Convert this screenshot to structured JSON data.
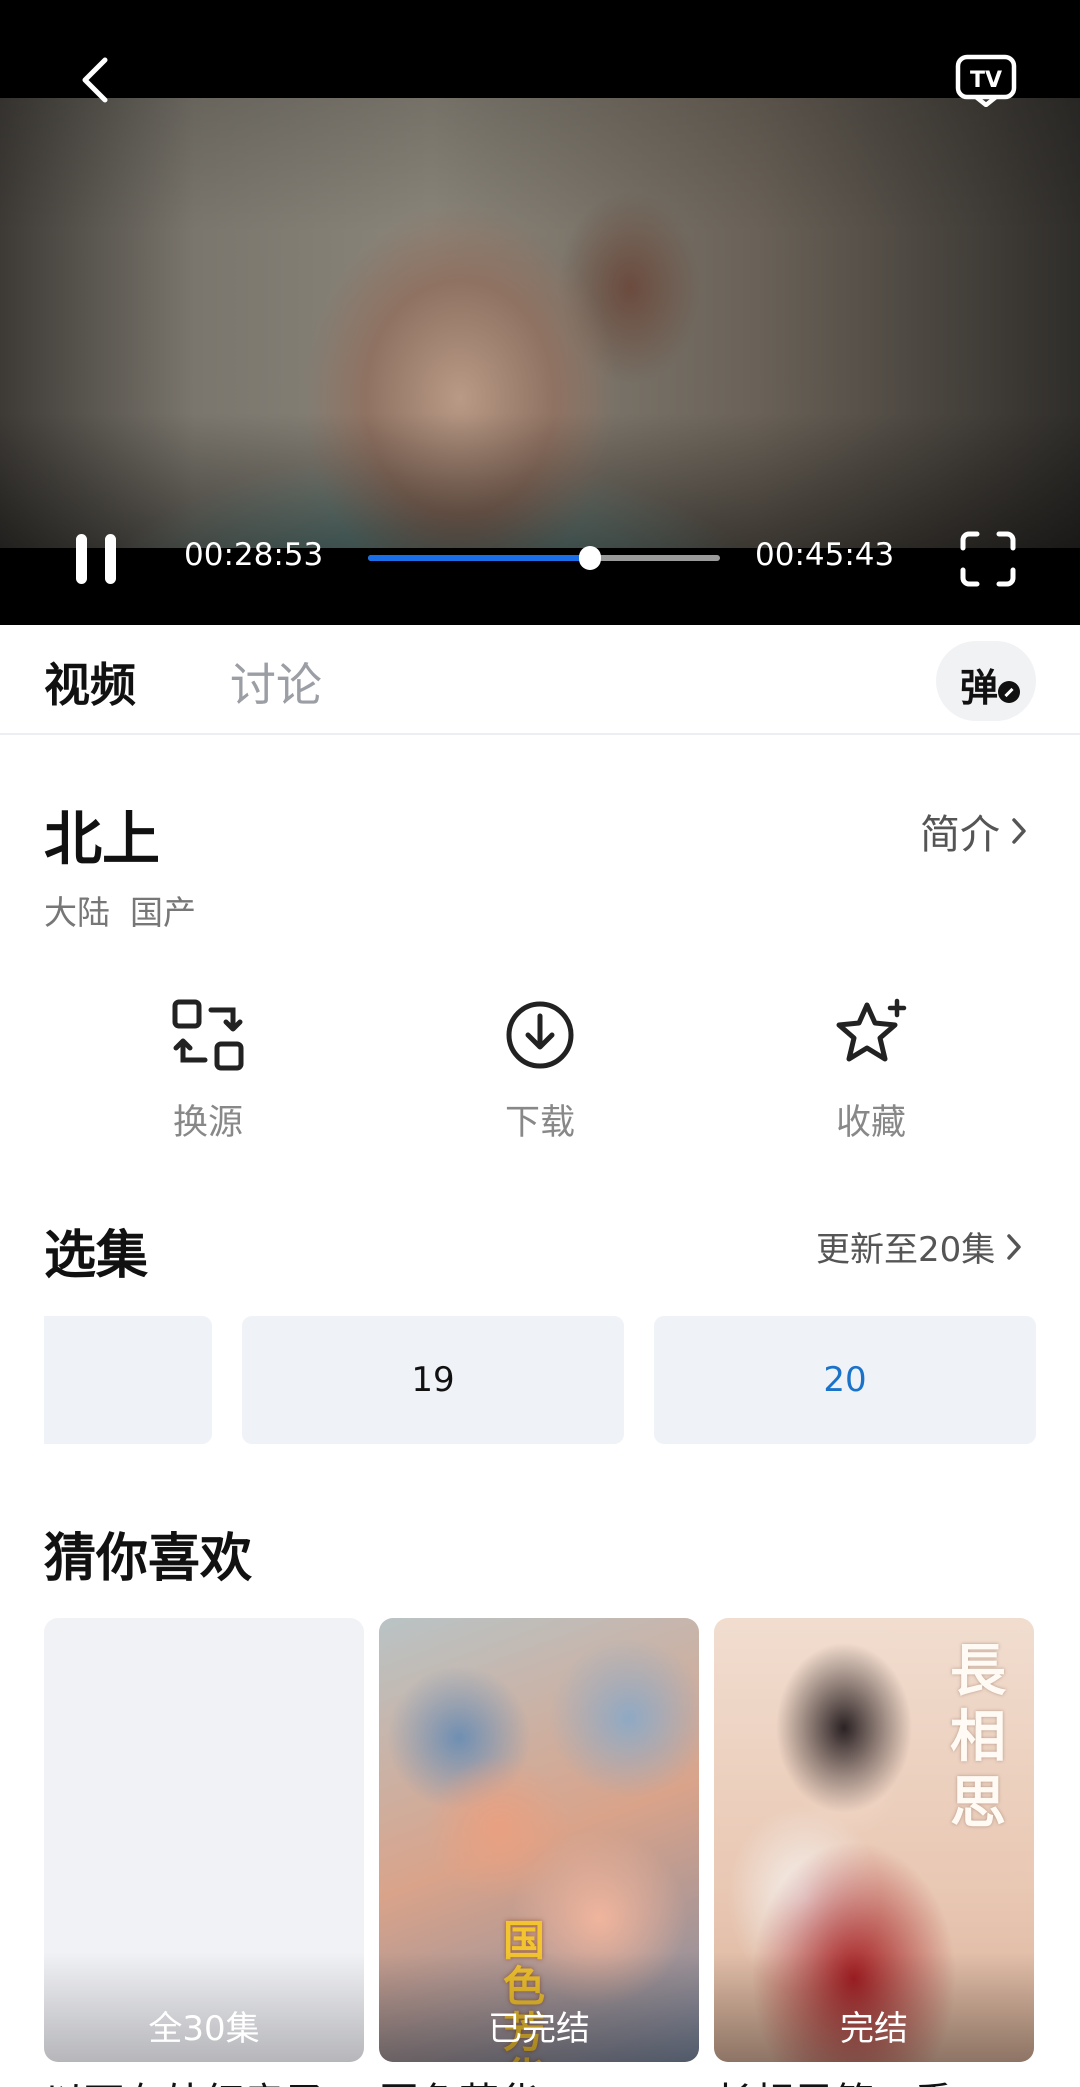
{
  "player": {
    "time_current": "00:28:53",
    "time_total": "00:45:43",
    "progress_fraction": 0.632,
    "accent_color": "#1a6fe8"
  },
  "tabs": {
    "video": "视频",
    "discuss": "讨论",
    "danmaku": "弹"
  },
  "show": {
    "title": "北上",
    "intro_link": "简介",
    "meta": [
      "大陆",
      "国产"
    ]
  },
  "actions": {
    "switch_source": "换源",
    "download": "下载",
    "favorite": "收藏"
  },
  "episodes": {
    "title": "选集",
    "update_status": "更新至20集",
    "items": [
      "19",
      "20"
    ],
    "selected_color": "#1a73c9"
  },
  "recommend": {
    "title": "猜你喜欢",
    "cards": [
      {
        "badge": "全30集",
        "title": "以下有处红房子"
      },
      {
        "badge": "已完结",
        "title": "国色芳华",
        "poster_text": "国色芳华"
      },
      {
        "badge": "完结",
        "title": "长相思第一季",
        "poster_text": "長相思"
      }
    ]
  },
  "icons": [
    "back-icon",
    "tv-cast-icon",
    "pause-icon",
    "fullscreen-icon",
    "chevron-right-icon",
    "switch-source-icon",
    "download-icon",
    "favorite-star-icon"
  ]
}
